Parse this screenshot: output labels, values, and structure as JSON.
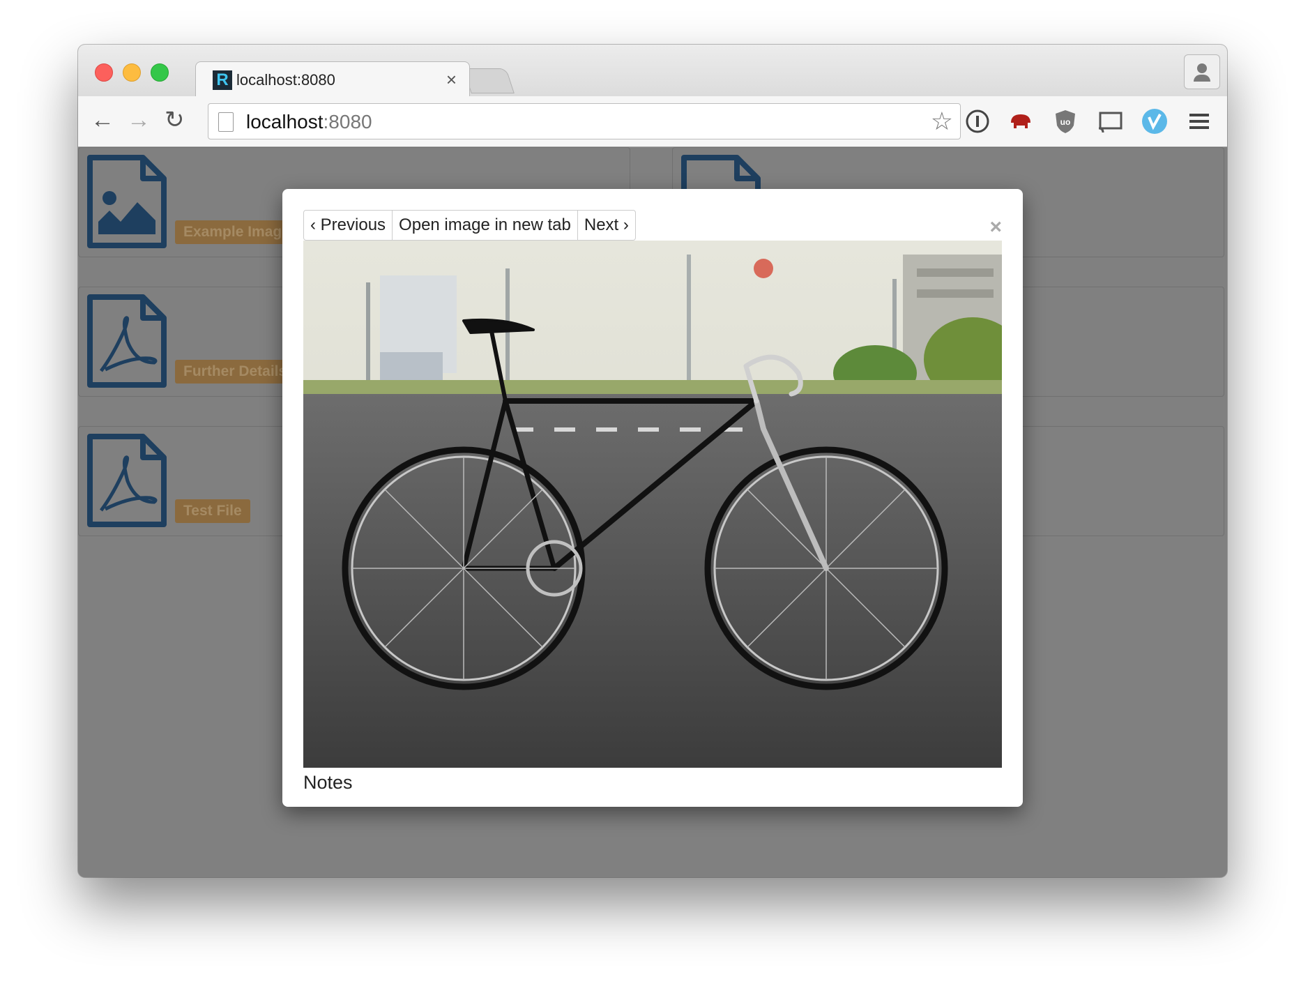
{
  "browser": {
    "tab_title": "localhost:8080",
    "tab_close": "×",
    "favicon_letter": "R",
    "url_host": "localhost",
    "url_port": ":8080"
  },
  "files": [
    {
      "label": "Example Image",
      "type": "image"
    },
    {
      "label": "Further Details",
      "type": "pdf"
    },
    {
      "label": "Test File",
      "type": "pdf"
    }
  ],
  "modal": {
    "previous_label": "‹ Previous",
    "open_label": "Open image in new tab",
    "next_label": "Next ›",
    "close_label": "×",
    "caption": "Notes"
  },
  "colors": {
    "icon_blue": "#1e3f5f",
    "label_bg": "#8b6a3e",
    "overlay": "#808080"
  }
}
